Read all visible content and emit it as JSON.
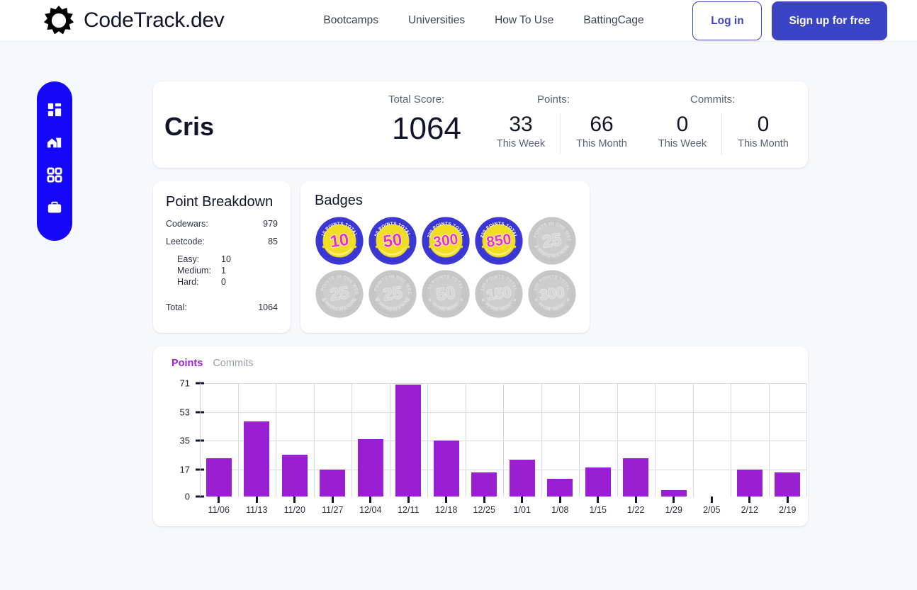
{
  "header": {
    "brand": "CodeTrack.dev",
    "logo_icon": "gear-sun-icon",
    "nav": [
      {
        "label": "Bootcamps"
      },
      {
        "label": "Universities"
      },
      {
        "label": "How To Use"
      },
      {
        "label": "BattingCage"
      }
    ],
    "login_label": "Log in",
    "signup_label": "Sign up for free",
    "accent": "#3b44c4"
  },
  "sidebar": {
    "background": "#1408f7",
    "items": [
      {
        "icon": "dashboard-grid-icon",
        "name": "dashboard"
      },
      {
        "icon": "house-chart-icon",
        "name": "bootcamps"
      },
      {
        "icon": "four-squares-icon",
        "name": "apps"
      },
      {
        "icon": "briefcase-icon",
        "name": "jobs"
      }
    ]
  },
  "summary": {
    "user_name": "Cris",
    "total_score_label": "Total Score:",
    "points_label": "Points:",
    "commits_label": "Commits:",
    "total_score": "1064",
    "stats": [
      {
        "value": "33",
        "sub": "This Week"
      },
      {
        "value": "66",
        "sub": "This Month"
      },
      {
        "value": "0",
        "sub": "This Week"
      },
      {
        "value": "0",
        "sub": "This Month"
      }
    ]
  },
  "breakdown": {
    "title": "Point Breakdown",
    "codewars_label": "Codewars:",
    "codewars_value": "979",
    "leetcode_label": "Leetcode:",
    "leetcode_value": "85",
    "easy_label": "Easy:",
    "easy_value": "10",
    "medium_label": "Medium:",
    "medium_value": "1",
    "hard_label": "Hard:",
    "hard_value": "0",
    "total_label": "Total:",
    "total_value": "1064"
  },
  "badges": {
    "title": "Badges",
    "earned_color": "#3b38d6",
    "locked_color": "#c6c6c6",
    "items": [
      {
        "number": "10",
        "top_text": "10 POINTS TOTAL",
        "bottom_text": "",
        "earned": true
      },
      {
        "number": "50",
        "top_text": "50 POINTS TOTAL",
        "bottom_text": "",
        "earned": true
      },
      {
        "number": "300",
        "top_text": "300 POINTS TOTAL",
        "bottom_text": "",
        "earned": true
      },
      {
        "number": "850",
        "top_text": "850 POINTS TOTAL",
        "bottom_text": "",
        "earned": true
      },
      {
        "number": "25",
        "top_text": "25 POINTS IN ONE WEEK",
        "bottom_text": "2 WEEKS IN A ROW!",
        "earned": false
      },
      {
        "number": "25",
        "top_text": "25 POINTS IN ONE WEEK",
        "bottom_text": "6 WEEKS IN A ROW!",
        "earned": false
      },
      {
        "number": "25",
        "top_text": "25 POINTS IN ONE WEEK",
        "bottom_text": "16 WEEKS IN A ROW!",
        "earned": false
      },
      {
        "number": "50",
        "top_text": "50 POINTS TOTAL",
        "bottom_text": "IN ONE WEEK!",
        "earned": false
      },
      {
        "number": "150",
        "top_text": "150 POINTS TOTAL",
        "bottom_text": "IN ONE WEEK!",
        "earned": false
      },
      {
        "number": "300",
        "top_text": "300 POINTS TOTAL",
        "bottom_text": "IN ONE WEEK!",
        "earned": false
      }
    ]
  },
  "chart_panel": {
    "tabs": [
      {
        "label": "Points",
        "active": true
      },
      {
        "label": "Commits",
        "active": false
      }
    ]
  },
  "chart_data": {
    "type": "bar",
    "title": "",
    "xlabel": "",
    "ylabel": "",
    "ylim": [
      0,
      71
    ],
    "yticks": [
      0,
      17,
      35,
      53,
      71
    ],
    "grid": true,
    "bar_color": "#9b1fd2",
    "categories": [
      "11/06",
      "11/13",
      "11/20",
      "11/27",
      "12/04",
      "12/11",
      "12/18",
      "12/25",
      "1/01",
      "1/08",
      "1/15",
      "1/22",
      "1/29",
      "2/05",
      "2/12",
      "2/19"
    ],
    "values": [
      24,
      47,
      26,
      17,
      36,
      70,
      35,
      15,
      23,
      11,
      18,
      24,
      4,
      0,
      17,
      15
    ],
    "series": [
      {
        "name": "Points",
        "values": [
          24,
          47,
          26,
          17,
          36,
          70,
          35,
          15,
          23,
          11,
          18,
          24,
          4,
          0,
          17,
          15
        ]
      }
    ]
  }
}
